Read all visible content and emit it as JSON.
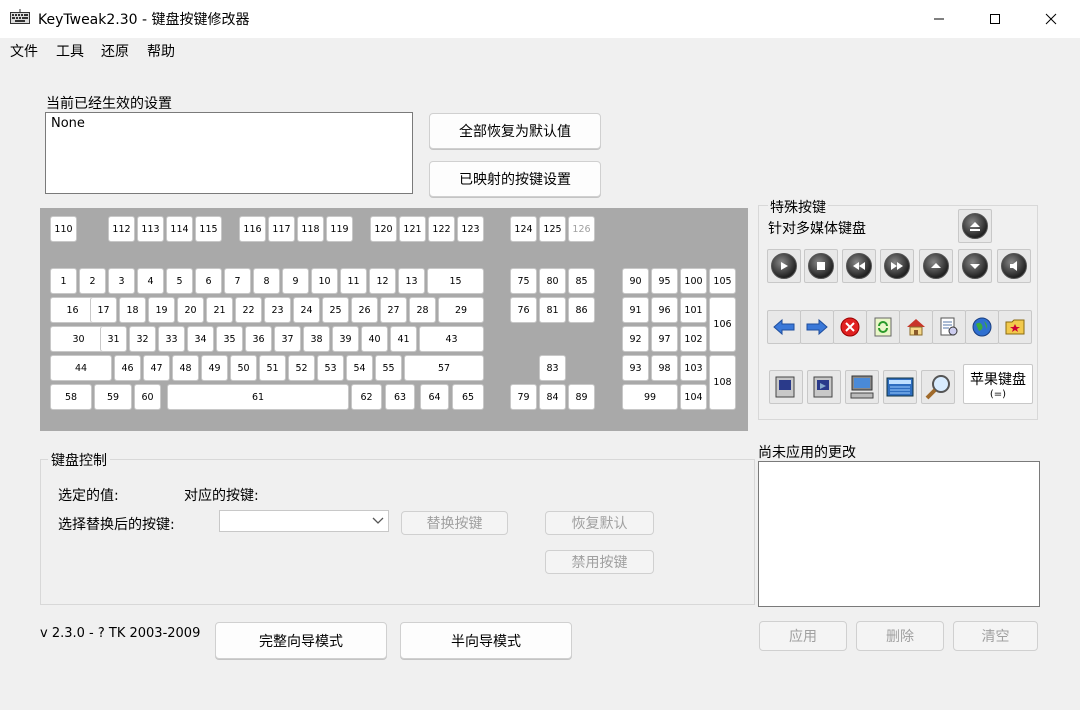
{
  "window": {
    "title": "KeyTweak2.30 -  键盘按键修改器",
    "icons": {
      "app": "keyboard-icon",
      "minimize": "minimize-icon",
      "maximize": "maximize-icon",
      "close": "close-icon"
    }
  },
  "menu": [
    "文件",
    "工具",
    "还原",
    "帮助"
  ],
  "current_settings": {
    "label": "当前已经生效的设置",
    "value": "None"
  },
  "buttons": {
    "restore_all": "全部恢复为默认值",
    "mapped_keys": "已映射的按键设置",
    "remap": "替换按键",
    "restore_default": "恢复默认",
    "disable_key": "禁用按键",
    "full_wizard": "完整向导模式",
    "half_wizard": "半向导模式",
    "apply": "应用",
    "delete": "删除",
    "clear": "清空"
  },
  "keyboard": {
    "keys": [
      "110",
      "112",
      "113",
      "114",
      "115",
      "116",
      "117",
      "118",
      "119",
      "120",
      "121",
      "122",
      "123",
      "124",
      "125",
      "126",
      "1",
      "2",
      "3",
      "4",
      "5",
      "6",
      "7",
      "8",
      "9",
      "10",
      "11",
      "12",
      "13",
      "15",
      "16",
      "17",
      "18",
      "19",
      "20",
      "21",
      "22",
      "23",
      "24",
      "25",
      "26",
      "27",
      "28",
      "29",
      "30",
      "31",
      "32",
      "33",
      "34",
      "35",
      "36",
      "37",
      "38",
      "39",
      "40",
      "41",
      "43",
      "44",
      "46",
      "47",
      "48",
      "49",
      "50",
      "51",
      "52",
      "53",
      "54",
      "55",
      "57",
      "58",
      "59",
      "60",
      "61",
      "62",
      "63",
      "64",
      "65",
      "75",
      "80",
      "85",
      "76",
      "81",
      "86",
      "83",
      "79",
      "84",
      "89",
      "90",
      "95",
      "100",
      "105",
      "91",
      "96",
      "101",
      "106",
      "92",
      "97",
      "102",
      "93",
      "98",
      "103",
      "108",
      "99",
      "104"
    ],
    "disabled_keys": [
      "126"
    ]
  },
  "special_keys": {
    "label": "特殊按键",
    "sublabel": "针对多媒体键盘",
    "media_icons": [
      "eject-icon",
      "play-icon",
      "stop-icon",
      "prev-track-icon",
      "next-track-icon",
      "volume-up-icon",
      "volume-down-icon",
      "mute-icon"
    ],
    "browser_icons": [
      "back-arrow-icon",
      "forward-arrow-icon",
      "stop-icon",
      "refresh-icon",
      "home-icon",
      "search-doc-icon",
      "globe-icon",
      "favorites-icon"
    ],
    "app_icons": [
      "sleep-icon",
      "power-icon",
      "computer-icon",
      "calculator-icon",
      "magnifier-icon"
    ],
    "apple_keyboard": "苹果键盘",
    "apple_keyboard_sub": "(=)"
  },
  "keyboard_control": {
    "label": "键盘控制",
    "selected_value": "选定的值:",
    "mapped_key": "对应的按键:",
    "choose_replacement": "选择替换后的按键:",
    "combo_value": ""
  },
  "pending": {
    "label": "尚未应用的更改"
  },
  "version": "v 2.3.0 - ? TK 2003-2009"
}
